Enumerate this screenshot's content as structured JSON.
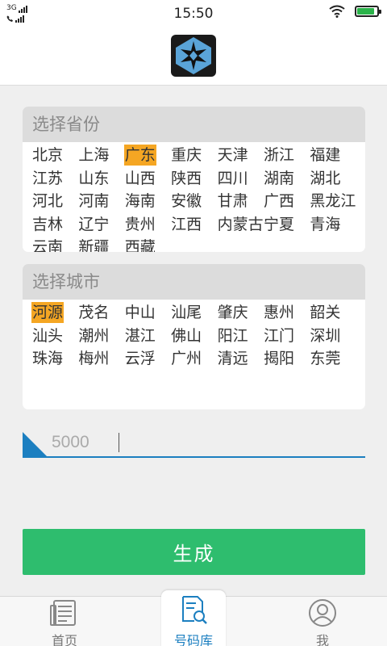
{
  "status_bar": {
    "network": "3G",
    "time": "15:50"
  },
  "province_panel": {
    "title": "选择省份",
    "items": [
      {
        "label": "北京",
        "selected": false
      },
      {
        "label": "上海",
        "selected": false
      },
      {
        "label": "广东",
        "selected": true
      },
      {
        "label": "重庆",
        "selected": false
      },
      {
        "label": "天津",
        "selected": false
      },
      {
        "label": "浙江",
        "selected": false
      },
      {
        "label": "福建",
        "selected": false
      },
      {
        "label": "江苏",
        "selected": false
      },
      {
        "label": "山东",
        "selected": false
      },
      {
        "label": "山西",
        "selected": false
      },
      {
        "label": "陕西",
        "selected": false
      },
      {
        "label": "四川",
        "selected": false
      },
      {
        "label": "湖南",
        "selected": false
      },
      {
        "label": "湖北",
        "selected": false
      },
      {
        "label": "河北",
        "selected": false
      },
      {
        "label": "河南",
        "selected": false
      },
      {
        "label": "海南",
        "selected": false
      },
      {
        "label": "安徽",
        "selected": false
      },
      {
        "label": "甘肃",
        "selected": false
      },
      {
        "label": "广西",
        "selected": false
      },
      {
        "label": "黑龙江",
        "selected": false
      },
      {
        "label": "吉林",
        "selected": false
      },
      {
        "label": "辽宁",
        "selected": false
      },
      {
        "label": "贵州",
        "selected": false
      },
      {
        "label": "江西",
        "selected": false
      },
      {
        "label": "内蒙古",
        "selected": false
      },
      {
        "label": "宁夏",
        "selected": false
      },
      {
        "label": "青海",
        "selected": false
      },
      {
        "label": "云南",
        "selected": false
      },
      {
        "label": "新疆",
        "selected": false
      },
      {
        "label": "西藏",
        "selected": false
      }
    ]
  },
  "city_panel": {
    "title": "选择城市",
    "items": [
      {
        "label": "河源",
        "selected": true
      },
      {
        "label": "茂名",
        "selected": false
      },
      {
        "label": "中山",
        "selected": false
      },
      {
        "label": "汕尾",
        "selected": false
      },
      {
        "label": "肇庆",
        "selected": false
      },
      {
        "label": "惠州",
        "selected": false
      },
      {
        "label": "韶关",
        "selected": false
      },
      {
        "label": "汕头",
        "selected": false
      },
      {
        "label": "潮州",
        "selected": false
      },
      {
        "label": "湛江",
        "selected": false
      },
      {
        "label": "佛山",
        "selected": false
      },
      {
        "label": "阳江",
        "selected": false
      },
      {
        "label": "江门",
        "selected": false
      },
      {
        "label": "深圳",
        "selected": false
      },
      {
        "label": "珠海",
        "selected": false
      },
      {
        "label": "梅州",
        "selected": false
      },
      {
        "label": "云浮",
        "selected": false
      },
      {
        "label": "广州",
        "selected": false
      },
      {
        "label": "清远",
        "selected": false
      },
      {
        "label": "揭阳",
        "selected": false
      },
      {
        "label": "东莞",
        "selected": false
      }
    ]
  },
  "quantity_input": {
    "value": "5000",
    "accent_color": "#1c7fc0"
  },
  "generate_button": {
    "label": "生成",
    "color": "#2ebd6e"
  },
  "tabs": [
    {
      "label": "首页",
      "icon": "newspaper-icon",
      "active": false
    },
    {
      "label": "号码库",
      "icon": "document-search-icon",
      "active": true
    },
    {
      "label": "我",
      "icon": "user-icon",
      "active": false
    }
  ],
  "colors": {
    "selected_highlight": "#f5a623",
    "active_tab": "#1c7fc0"
  }
}
